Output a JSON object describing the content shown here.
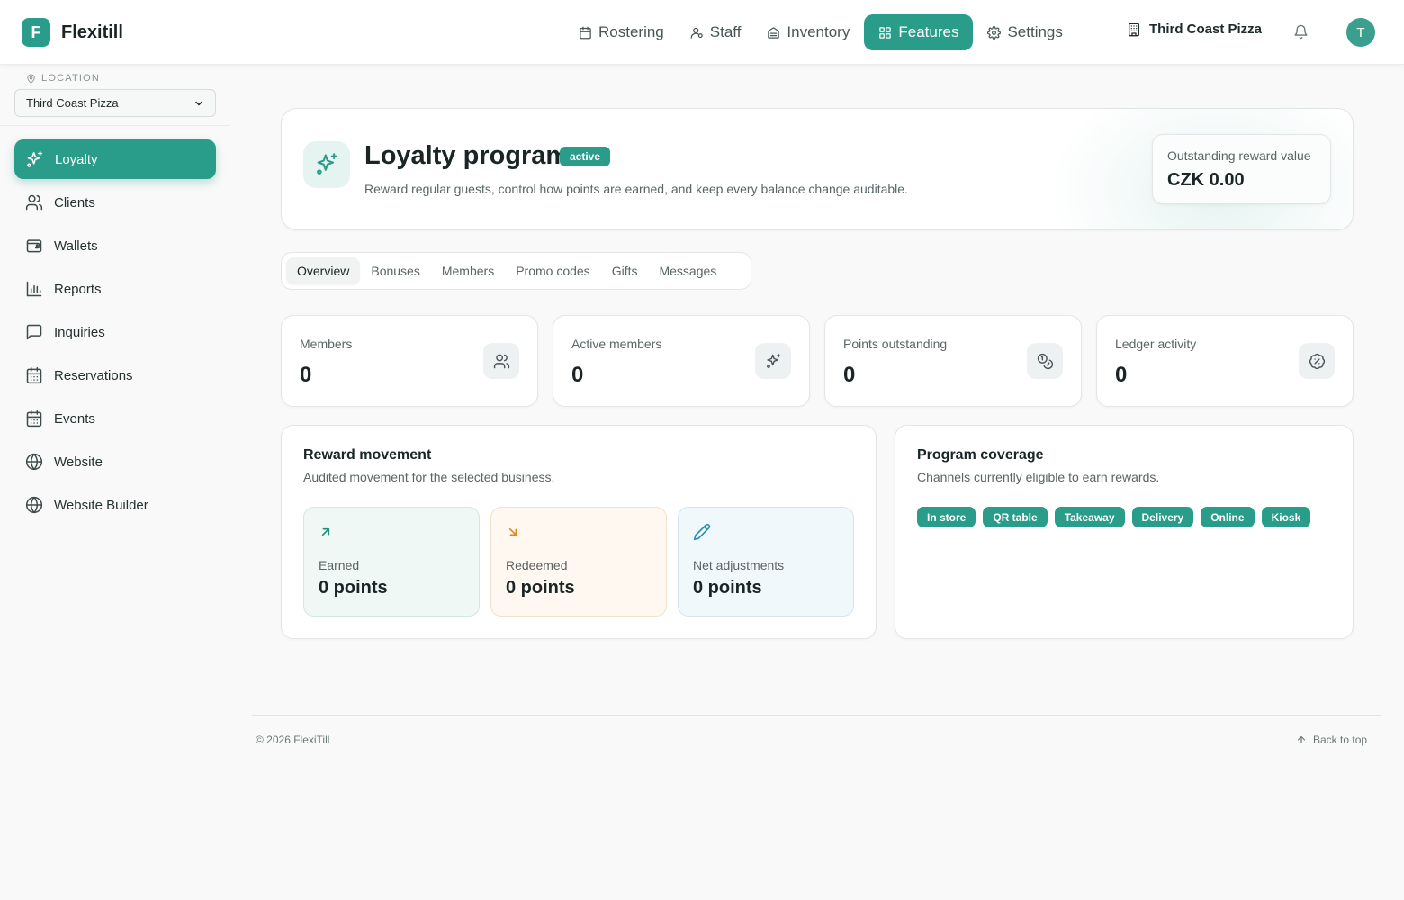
{
  "brand": {
    "logo_letter": "F",
    "name": "Flexitill"
  },
  "nav": [
    {
      "label": "Rostering",
      "icon": "calendar-icon"
    },
    {
      "label": "Staff",
      "icon": "staff-icon"
    },
    {
      "label": "Inventory",
      "icon": "inventory-icon"
    },
    {
      "label": "Features",
      "icon": "grid-icon",
      "active": true
    },
    {
      "label": "Settings",
      "icon": "gear-icon"
    }
  ],
  "header": {
    "tenant": "Third Coast Pizza",
    "avatar_letter": "T"
  },
  "sidebar": {
    "location_label": "LOCATION",
    "location_value": "Third Coast Pizza",
    "items": [
      {
        "label": "Loyalty",
        "icon": "sparkles-icon",
        "active": true
      },
      {
        "label": "Clients",
        "icon": "users-icon"
      },
      {
        "label": "Wallets",
        "icon": "wallet-icon"
      },
      {
        "label": "Reports",
        "icon": "bar-chart-icon"
      },
      {
        "label": "Inquiries",
        "icon": "message-icon"
      },
      {
        "label": "Reservations",
        "icon": "calendar-icon"
      },
      {
        "label": "Events",
        "icon": "calendar-icon"
      },
      {
        "label": "Website",
        "icon": "globe-icon"
      },
      {
        "label": "Website Builder",
        "icon": "globe-icon"
      }
    ]
  },
  "hero": {
    "title": "Loyalty program",
    "badge": "active",
    "subtitle": "Reward regular guests, control how points are earned, and keep every balance change auditable.",
    "reward_label": "Outstanding reward value",
    "reward_value": "CZK 0.00"
  },
  "tabs": [
    "Overview",
    "Bonuses",
    "Members",
    "Promo codes",
    "Gifts",
    "Messages"
  ],
  "stats": [
    {
      "label": "Members",
      "value": "0",
      "icon": "users-icon"
    },
    {
      "label": "Active members",
      "value": "0",
      "icon": "sparkles-icon"
    },
    {
      "label": "Points outstanding",
      "value": "0",
      "icon": "coins-icon"
    },
    {
      "label": "Ledger activity",
      "value": "0",
      "icon": "badge-percent-icon"
    }
  ],
  "reward_movement": {
    "title": "Reward movement",
    "subtitle": "Audited movement for the selected business.",
    "items": [
      {
        "label": "Earned",
        "value": "0 points",
        "icon": "arrow-up-right-icon",
        "color": "#1f8f75"
      },
      {
        "label": "Redeemed",
        "value": "0 points",
        "icon": "arrow-down-right-icon",
        "color": "#d98a1a"
      },
      {
        "label": "Net adjustments",
        "value": "0 points",
        "icon": "pencil-icon",
        "color": "#2a8fb8"
      }
    ]
  },
  "program_coverage": {
    "title": "Program coverage",
    "subtitle": "Channels currently eligible to earn rewards.",
    "channels": [
      "In store",
      "QR table",
      "Takeaway",
      "Delivery",
      "Online",
      "Kiosk"
    ]
  },
  "footer": {
    "copyright": "© 2026 FlexiTill",
    "back_to_top": "Back to top"
  },
  "colors": {
    "accent": "#2a9d8a",
    "background": "#f9f9f9"
  }
}
